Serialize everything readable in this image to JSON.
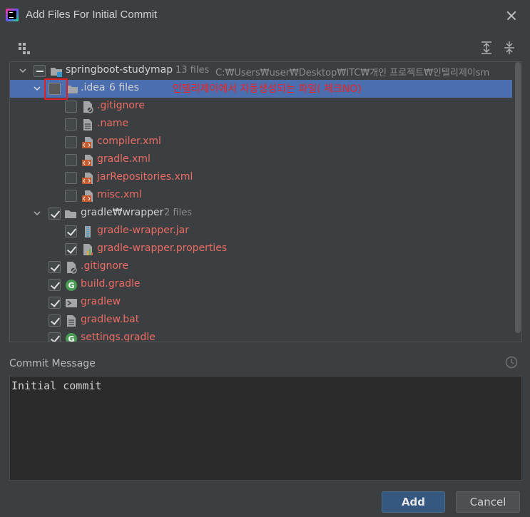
{
  "window": {
    "title": "Add Files For Initial Commit"
  },
  "tree": {
    "root": {
      "label": "springboot-studymap",
      "count": "13 files",
      "path": "C:₩Users₩user₩Desktop₩ITC₩개인 프로젝트₩인텔리제이sm"
    },
    "idea": {
      "label": ".idea",
      "count": "6 files",
      "annotation": "인텔리제이에서 자동생성되는 파일( 체크NO)"
    },
    "idea_files": [
      ".gitignore",
      ".name",
      "compiler.xml",
      "gradle.xml",
      "jarRepositories.xml",
      "misc.xml"
    ],
    "wrapper": {
      "label": "gradle₩wrapper",
      "count": "2 files"
    },
    "wrapper_files": [
      "gradle-wrapper.jar",
      "gradle-wrapper.properties"
    ],
    "root_files": [
      ".gitignore",
      "build.gradle",
      "gradlew",
      "gradlew.bat",
      "settings.gradle"
    ]
  },
  "commit": {
    "label": "Commit Message",
    "message": "Initial commit"
  },
  "buttons": {
    "add": "Add",
    "cancel": "Cancel"
  },
  "colors": {
    "accent": "#4b6eaf",
    "unversioned_file": "#ec6b63",
    "annotation": "#ee2222"
  },
  "icons": [
    "group-by-icon",
    "expand-all-icon",
    "collapse-all-icon",
    "folder-icon",
    "file-icon",
    "gradle-icon",
    "terminal-icon",
    "history-icon",
    "close-icon"
  ]
}
